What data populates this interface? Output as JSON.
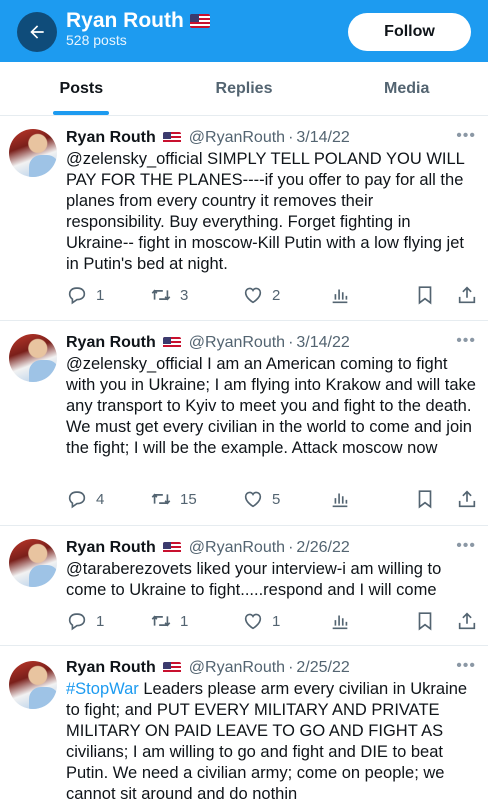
{
  "header": {
    "title": "Ryan Routh",
    "subtitle": "528 posts",
    "follow_label": "Follow"
  },
  "tabs": [
    {
      "label": "Posts",
      "active": true
    },
    {
      "label": "Replies",
      "active": false
    },
    {
      "label": "Media",
      "active": false
    }
  ],
  "tweets": [
    {
      "name": "Ryan Routh",
      "handle": "@RyanRouth",
      "date": "3/14/22",
      "text": "@zelensky_official SIMPLY TELL POLAND YOU WILL PAY FOR THE PLANES----if you offer to pay for all the planes from every country it removes their responsibility.  Buy everything.  Forget fighting in Ukraine-- fight in moscow-Kill Putin with a low flying jet in Putin's bed at night.",
      "replies": "1",
      "retweets": "3",
      "likes": "2"
    },
    {
      "name": "Ryan Routh",
      "handle": "@RyanRouth",
      "date": "3/14/22",
      "text": "@zelensky_official I am an American coming to fight with you in Ukraine; I am flying into Krakow and will take any transport to Kyiv to meet you and fight to the death.  We must get every civilian in the world to come and join the fight; I will be the example.  Attack moscow now",
      "replies": "4",
      "retweets": "15",
      "likes": "5"
    },
    {
      "name": "Ryan Routh",
      "handle": "@RyanRouth",
      "date": "2/26/22",
      "text": "@taraberezovets liked your interview-i am willing to come to Ukraine to fight.....respond and I will come",
      "replies": "1",
      "retweets": "1",
      "likes": "1"
    },
    {
      "name": "Ryan Routh",
      "handle": "@RyanRouth",
      "date": "2/25/22",
      "hashtag": "#StopWar",
      "text": " Leaders please arm every civilian in Ukraine to fight; and PUT EVERY MILITARY AND PRIVATE MILITARY ON PAID LEAVE TO GO AND FIGHT AS civilians; I am willing to go and fight and DIE to beat Putin.  We need a civilian army; come on people; we cannot sit around and do nothin"
    }
  ],
  "separator": "·",
  "icons": {
    "back": "arrow-left-icon",
    "flag": "us-flag-icon",
    "more": "more-dots-icon",
    "reply": "reply-icon",
    "retweet": "retweet-icon",
    "like": "heart-icon",
    "views": "views-icon",
    "bookmark": "bookmark-icon",
    "share": "share-icon"
  },
  "colors": {
    "header_bg": "#1d9bf0",
    "accent": "#1d9bf0",
    "text": "#0f1419",
    "muted": "#536471"
  }
}
